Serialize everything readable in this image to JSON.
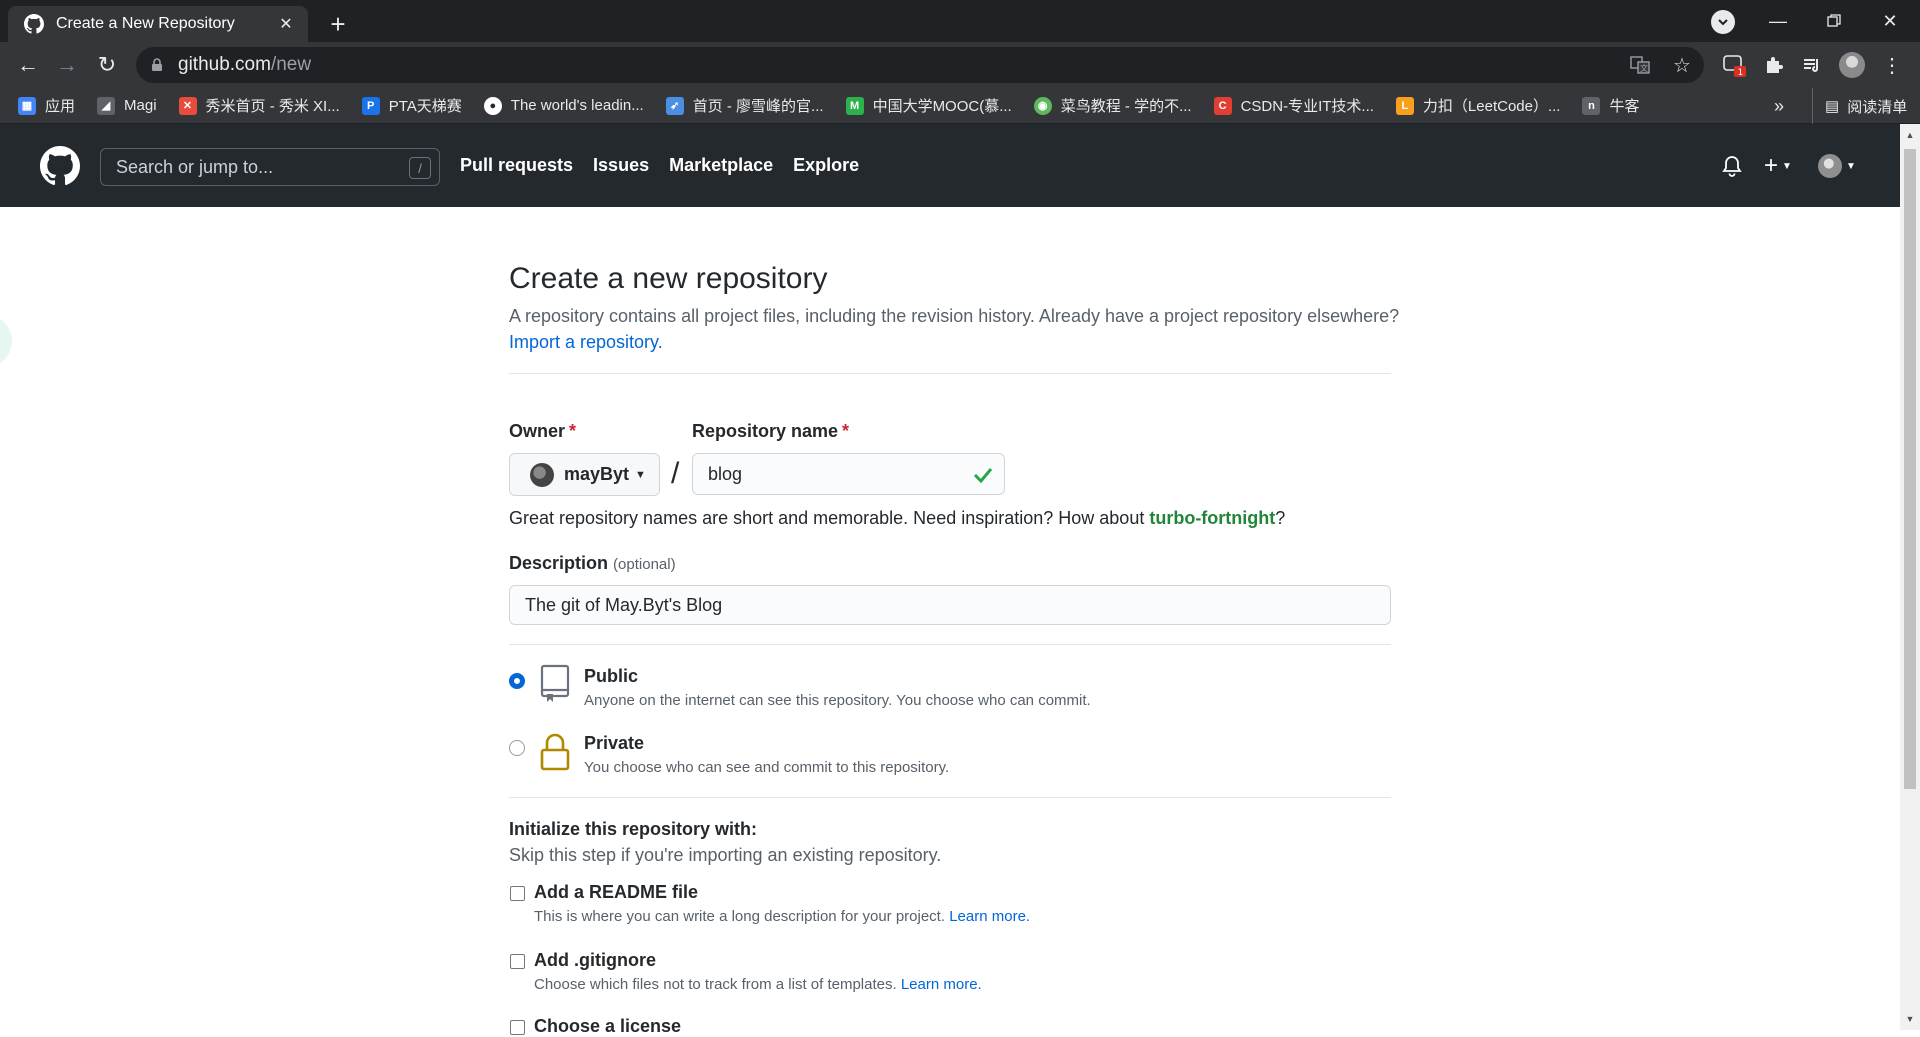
{
  "browser": {
    "tab_title": "Create a New Repository",
    "url_domain": "github.com",
    "url_path": "/new"
  },
  "bookmarks": [
    {
      "label": "应用",
      "icon": "apps-grid-icon",
      "color": "#4285f4"
    },
    {
      "label": "Magi",
      "icon": "magi-icon",
      "color": "#5f6368"
    },
    {
      "label": "秀米首页 - 秀米 XI...",
      "icon": "xiumi-icon",
      "color": "#e84c3d"
    },
    {
      "label": "PTA天梯赛",
      "icon": "pta-icon",
      "color": "#1a73e8"
    },
    {
      "label": "The world's leadin...",
      "icon": "github-icon",
      "color": "#ffffff"
    },
    {
      "label": "首页 - 廖雪峰的官...",
      "icon": "rocket-icon",
      "color": "#4a90e2"
    },
    {
      "label": "中国大学MOOC(慕...",
      "icon": "mooc-icon",
      "color": "#2bb24c"
    },
    {
      "label": "菜鸟教程 - 学的不...",
      "icon": "runoob-icon",
      "color": "#5fb85f"
    },
    {
      "label": "CSDN-专业IT技术...",
      "icon": "csdn-icon",
      "color": "#e33e33"
    },
    {
      "label": "力扣（LeetCode）...",
      "icon": "leetcode-icon",
      "color": "#f89f1b"
    },
    {
      "label": "牛客",
      "icon": "nowcoder-icon",
      "color": "#5f6368"
    }
  ],
  "bookmarks_more": "»",
  "reading_list": "阅读清单",
  "header": {
    "search_placeholder": "Search or jump to...",
    "search_shortcut": "/",
    "nav": [
      "Pull requests",
      "Issues",
      "Marketplace",
      "Explore"
    ]
  },
  "page": {
    "title": "Create a new repository",
    "subtitle": "A repository contains all project files, including the revision history. Already have a project repository elsewhere?",
    "import_link": "Import a repository.",
    "owner_label": "Owner",
    "required_mark": "*",
    "owner_value": "mayByt",
    "repo_label": "Repository name",
    "repo_value": "blog",
    "name_hint_prefix": "Great repository names are short and memorable. Need inspiration? How about ",
    "name_suggestion": "turbo-fortnight",
    "name_hint_suffix": "?",
    "description_label": "Description",
    "description_optional": "(optional)",
    "description_value": "The git of May.Byt's Blog",
    "visibility": [
      {
        "title": "Public",
        "desc": "Anyone on the internet can see this repository. You choose who can commit.",
        "selected": true
      },
      {
        "title": "Private",
        "desc": "You choose who can see and commit to this repository.",
        "selected": false
      }
    ],
    "init_heading": "Initialize this repository with:",
    "init_sub": "Skip this step if you're importing an existing repository.",
    "options": [
      {
        "title": "Add a README file",
        "desc": "This is where you can write a long description for your project.",
        "link": "Learn more."
      },
      {
        "title": "Add .gitignore",
        "desc": "Choose which files not to track from a list of templates.",
        "link": "Learn more."
      },
      {
        "title": "Choose a license",
        "desc": "",
        "link": ""
      }
    ]
  },
  "colors": {
    "github_header": "#24292e",
    "link": "#0366d6",
    "success": "#22863a",
    "required": "#cb2431"
  }
}
